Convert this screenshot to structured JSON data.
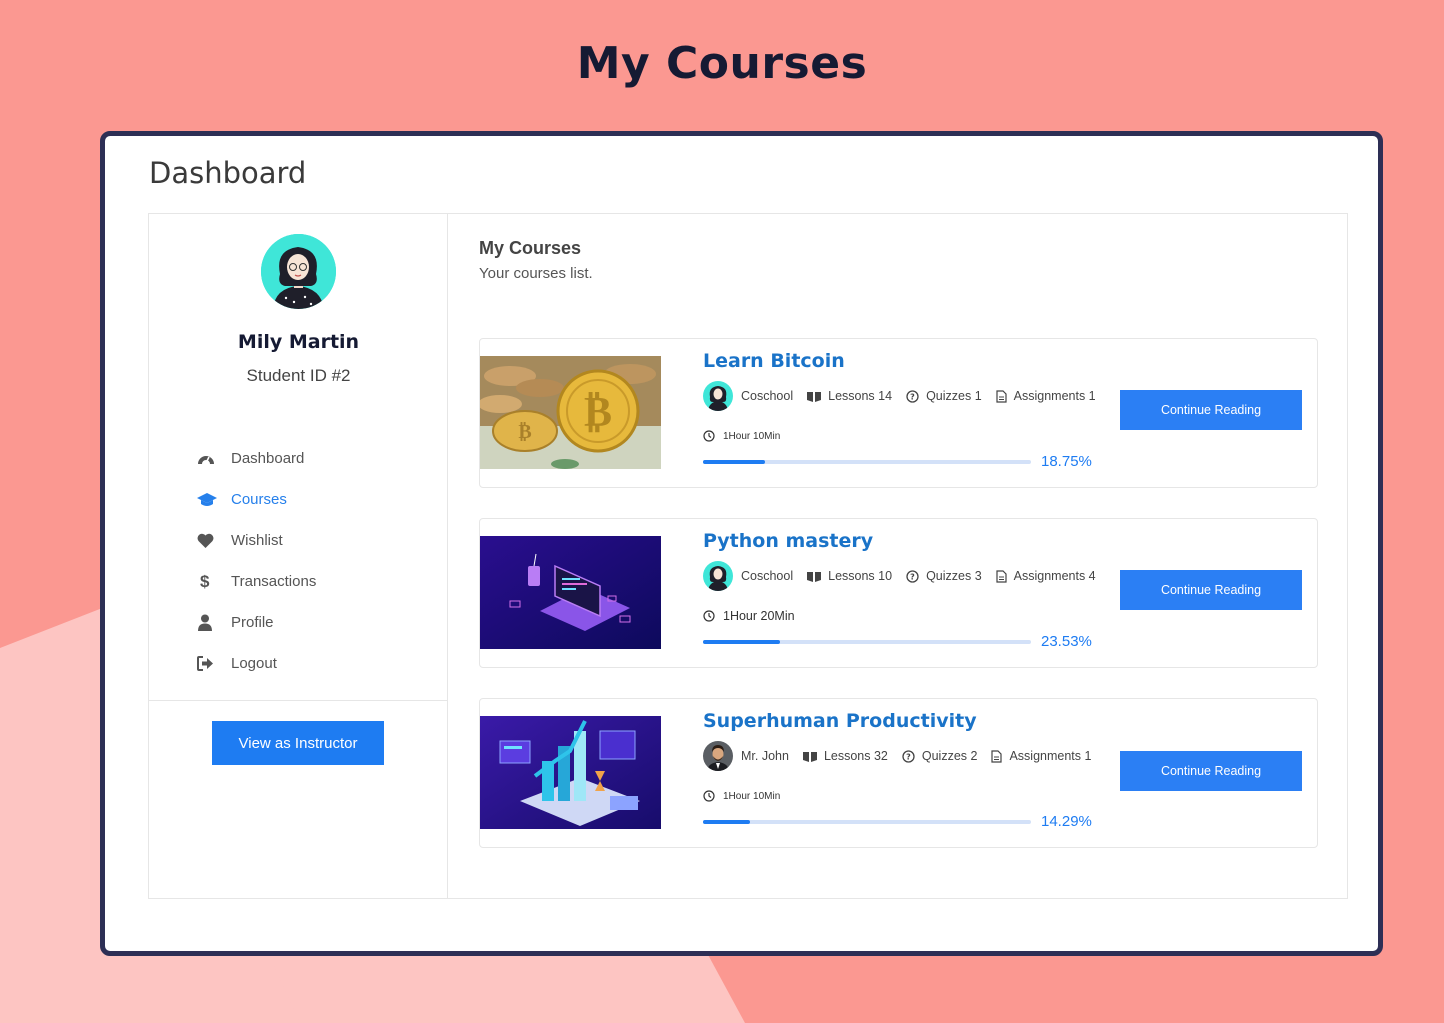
{
  "page": {
    "title": "My Courses"
  },
  "dashboard": {
    "title": "Dashboard"
  },
  "profile": {
    "name": "Mily Martin",
    "student_id": "Student ID #2"
  },
  "sidebar": {
    "items": [
      {
        "label": "Dashboard",
        "icon": "dashboard-icon"
      },
      {
        "label": "Courses",
        "icon": "graduation-cap-icon",
        "active": true
      },
      {
        "label": "Wishlist",
        "icon": "heart-icon"
      },
      {
        "label": "Transactions",
        "icon": "dollar-icon"
      },
      {
        "label": "Profile",
        "icon": "user-icon"
      },
      {
        "label": "Logout",
        "icon": "logout-icon"
      }
    ],
    "instructor_button": "View as Instructor"
  },
  "content": {
    "title": "My Courses",
    "subtitle": "Your courses list."
  },
  "courses": [
    {
      "title": "Learn Bitcoin",
      "author": "Coschool",
      "lessons": "Lessons 14",
      "quizzes": "Quizzes 1",
      "assignments": "Assignments 1",
      "duration": "1Hour 10Min",
      "progress": 18.75,
      "progress_label": "18.75%",
      "button": "Continue Reading"
    },
    {
      "title": "Python mastery",
      "author": "Coschool",
      "lessons": "Lessons 10",
      "quizzes": "Quizzes 3",
      "assignments": "Assignments 4",
      "duration": "1Hour 20Min",
      "progress": 23.53,
      "progress_label": "23.53%",
      "button": "Continue Reading"
    },
    {
      "title": "Superhuman Productivity",
      "author": "Mr. John",
      "lessons": "Lessons 32",
      "quizzes": "Quizzes 2",
      "assignments": "Assignments 1",
      "duration": "1Hour 10Min",
      "progress": 14.29,
      "progress_label": "14.29%",
      "button": "Continue Reading"
    }
  ],
  "colors": {
    "accent": "#1e7cf2",
    "background": "#fb9891",
    "frame": "#2d2f55",
    "title": "#151a33"
  }
}
